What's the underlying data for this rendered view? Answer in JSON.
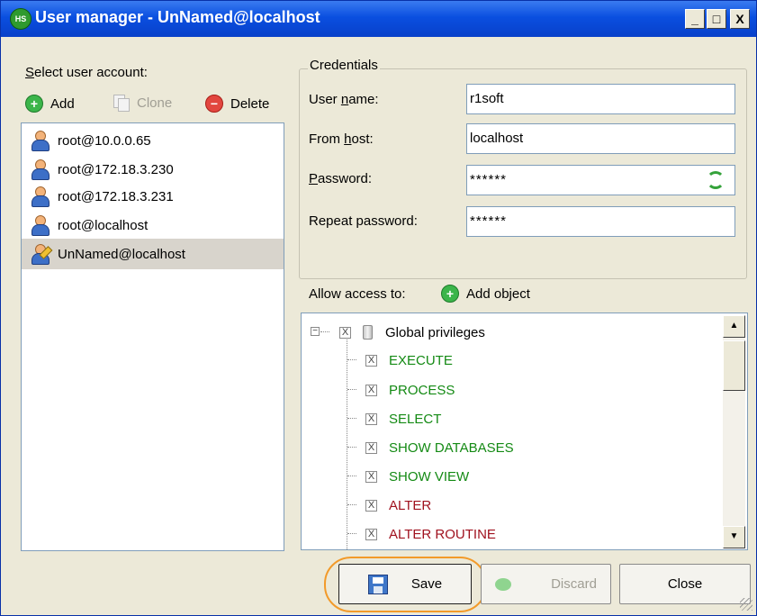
{
  "window": {
    "app_icon_text": "HS",
    "title": "User manager - UnNamed@localhost",
    "controls": {
      "minimize": "_",
      "maximize": "□",
      "close": "X"
    }
  },
  "left": {
    "select_label_prefix": "S",
    "select_label_rest": "elect user account:",
    "toolbar": {
      "add": "Add",
      "clone": "Clone",
      "delete": "Delete"
    },
    "users": [
      {
        "name": "root@10.0.0.65",
        "selected": false
      },
      {
        "name": "root@172.18.3.230",
        "selected": false
      },
      {
        "name": "root@172.18.3.231",
        "selected": false
      },
      {
        "name": "root@localhost",
        "selected": false
      },
      {
        "name": "UnNamed@localhost",
        "selected": true
      }
    ]
  },
  "credentials": {
    "group_title": "Credentials",
    "username_label_a": "User ",
    "username_label_u": "n",
    "username_label_b": "ame:",
    "username_value": "r1soft",
    "fromhost_label_a": "From ",
    "fromhost_label_u": "h",
    "fromhost_label_b": "ost:",
    "fromhost_value": "localhost",
    "password_label_u": "P",
    "password_label_b": "assword:",
    "password_value": "******",
    "repeat_label": "Repeat password:",
    "repeat_value": "******"
  },
  "access": {
    "label": "Allow access to:",
    "add_object": "Add object",
    "root": {
      "label": "Global privileges",
      "expander": "−",
      "checked": "X"
    },
    "privileges": [
      {
        "label": "EXECUTE",
        "color": "green"
      },
      {
        "label": "PROCESS",
        "color": "green"
      },
      {
        "label": "SELECT",
        "color": "green"
      },
      {
        "label": "SHOW DATABASES",
        "color": "green"
      },
      {
        "label": "SHOW VIEW",
        "color": "green"
      },
      {
        "label": "ALTER",
        "color": "red"
      },
      {
        "label": "ALTER ROUTINE",
        "color": "red"
      }
    ],
    "check_mark": "X"
  },
  "buttons": {
    "save": "Save",
    "discard": "Discard",
    "close": "Close"
  },
  "colors": {
    "granted": "#148a14",
    "revoked": "#a0121f",
    "highlight": "#f29a2a"
  }
}
